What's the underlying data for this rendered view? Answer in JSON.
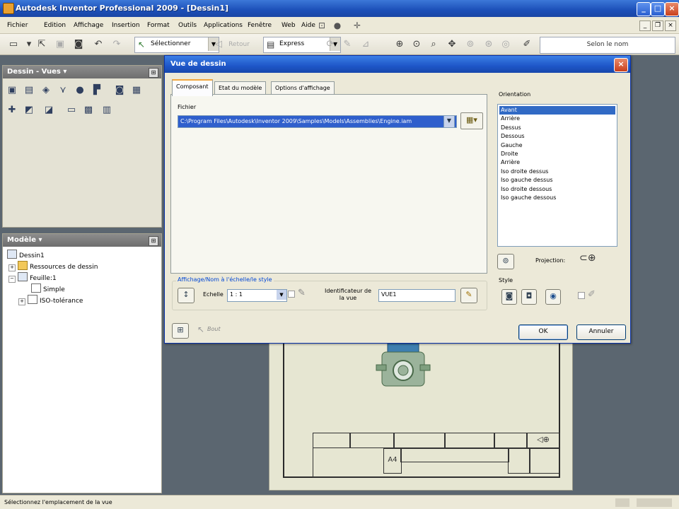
{
  "window": {
    "title": "Autodesk Inventor Professional 2009 - [Dessin1]"
  },
  "menu": [
    "Fichier",
    "Edition",
    "Affichage",
    "Insertion",
    "Format",
    "Outils",
    "Applications",
    "Fenêtre",
    "Web",
    "Aide"
  ],
  "toolbar": {
    "select_label": "Sélectionner",
    "return_label": "Retour",
    "express_label": "Express",
    "search_placeholder": "Selon le nom"
  },
  "panels": {
    "views_title": "Dessin - Vues",
    "model_title": "Modèle",
    "tree": [
      {
        "label": "Dessin1",
        "level": 0,
        "icon": "drawing-icon"
      },
      {
        "label": "Ressources de dessin",
        "level": 1,
        "icon": "folder-icon"
      },
      {
        "label": "Feuille:1",
        "level": 1,
        "icon": "sheet-icon"
      },
      {
        "label": "Simple",
        "level": 2,
        "icon": "border-icon"
      },
      {
        "label": "ISO-tolérance",
        "level": 2,
        "icon": "title-block-icon"
      }
    ]
  },
  "status": {
    "text": "Sélectionnez l'emplacement de la vue"
  },
  "dialog": {
    "title": "Vue de dessin",
    "tabs": [
      "Composant",
      "Etat du modèle",
      "Options d'affichage"
    ],
    "active_tab": "Composant",
    "file_label": "Fichier",
    "file_value": "C:\\Program Files\\Autodesk\\Inventor 2009\\Samples\\Models\\Assemblies\\Engine.iam",
    "scale_group": "Affichage/Nom à l'échelle/le style",
    "scale_label": "Echelle",
    "scale_value": "1 : 1",
    "identifier_label": "Identificateur de la vue",
    "identifier_value": "VUE1",
    "orientation_label": "Orientation",
    "orientations": [
      "Avant",
      "Arrière",
      "Dessus",
      "Dessous",
      "Gauche",
      "Droite",
      "Arrière",
      "Iso droite dessus",
      "Iso gauche dessus",
      "Iso droite dessous",
      "Iso gauche dessous"
    ],
    "selected_orientation": "Avant",
    "projection_label": "Projection:",
    "style_label": "Style",
    "ok_label": "OK",
    "cancel_label": "Annuler",
    "retour_label": "Bout"
  },
  "colors": {
    "title_blue": "#1c4fb8",
    "selection": "#316ac5",
    "chrome": "#ece9d8",
    "workspace": "#5b6670"
  }
}
